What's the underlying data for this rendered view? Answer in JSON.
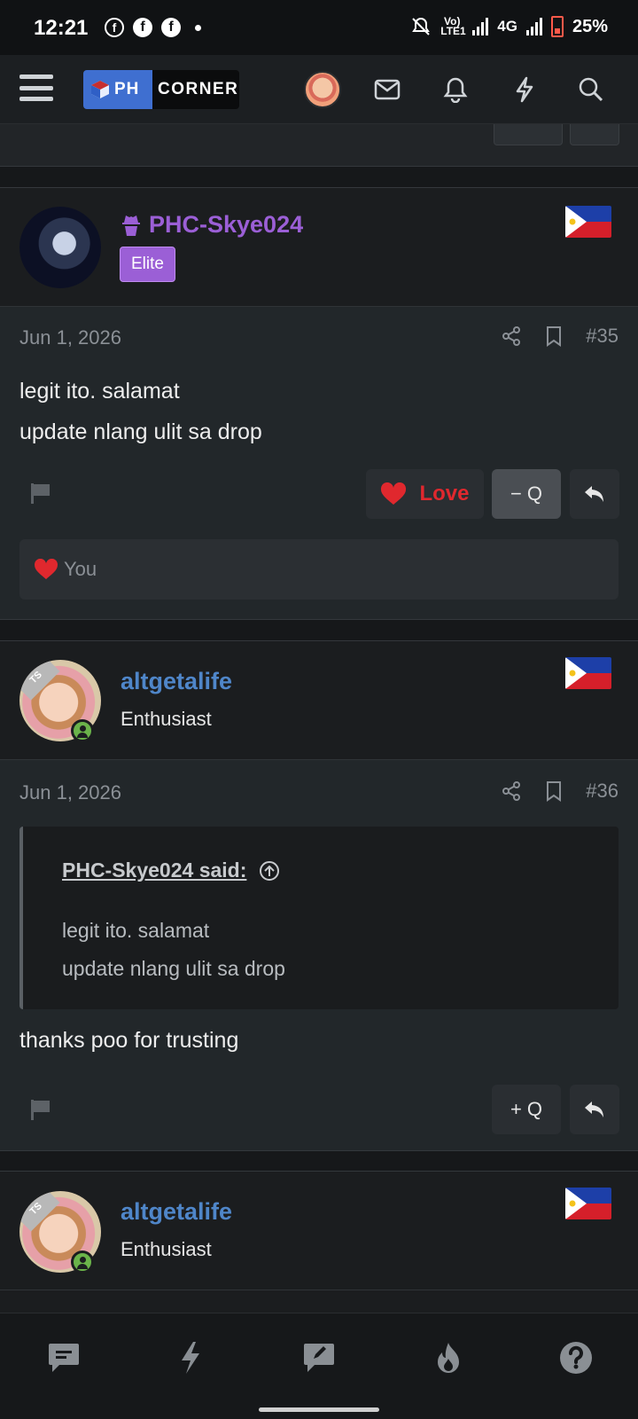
{
  "status_bar": {
    "time": "12:21",
    "network": "4G",
    "lte_label": "Vo) LTE1",
    "battery": "25%"
  },
  "header": {
    "logo_left": "PH",
    "logo_right": "CORNER"
  },
  "posts": [
    {
      "username": "PHC-Skye024",
      "username_color": "#9b5fd6",
      "user_badge": "Elite",
      "date": "Jun 1, 2026",
      "post_number": "#35",
      "lines": [
        "legit ito. salamat",
        "update nlang ulit sa drop"
      ],
      "reaction_label": "Love",
      "quote_label": "− Q",
      "reacted_by": "You"
    },
    {
      "username": "altgetalife",
      "username_color": "#4f86c9",
      "user_title": "Enthusiast",
      "ts_label": "TS",
      "date": "Jun 1, 2026",
      "post_number": "#36",
      "quote": {
        "attribution": "PHC-Skye024 said:",
        "lines": [
          "legit ito. salamat",
          "update nlang ulit sa drop"
        ]
      },
      "lines": [
        "thanks poo for trusting"
      ],
      "quote_label": "+ Q"
    },
    {
      "username": "altgetalife",
      "user_title": "Enthusiast",
      "ts_label": "TS"
    }
  ],
  "colors": {
    "accent_love": "#e0282e",
    "elite_badge": "#9b5fd6",
    "online": "#6bb34a"
  }
}
